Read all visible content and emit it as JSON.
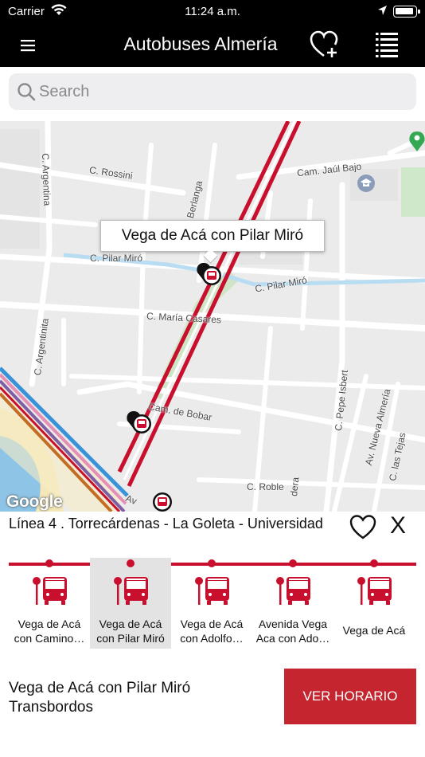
{
  "status": {
    "carrier": "Carrier",
    "time": "11:24 a.m."
  },
  "nav": {
    "title": "Autobuses Almería"
  },
  "search": {
    "placeholder": "Search",
    "value": ""
  },
  "map": {
    "callout": "Vega de Acá con Pilar Miró",
    "watermark": "Google",
    "street_labels": [
      "C. Argentina",
      "C. Rossini",
      "Cam. Jaúl Bajo",
      "C. Pilar Miró",
      "C. Pilar Miró",
      "C. María Casares",
      "C. Argentinita",
      "Cam. de Bobar",
      "C. Pepe Isbert",
      "C. Nueva Almería",
      "Av. Nueva Almería",
      "C. las Tejas",
      "C. Roble",
      "Berlanga",
      "dera",
      "Av"
    ]
  },
  "line": {
    "title": "Línea 4 . Torrecárdenas - La Goleta - Universidad",
    "close": "X"
  },
  "stops": [
    {
      "line1": "Vega de Acá",
      "line2": "con Camino…",
      "selected": false
    },
    {
      "line1": "Vega de Acá",
      "line2": "con Pilar Miró",
      "selected": true
    },
    {
      "line1": "Vega de Acá",
      "line2": "con Adolfo…",
      "selected": false
    },
    {
      "line1": "Avenida Vega",
      "line2": "Aca con Ado…",
      "selected": false
    },
    {
      "line1": "Vega de Acá",
      "line2": "",
      "selected": false
    }
  ],
  "detail": {
    "stop_name": "Vega de Acá con Pilar Miró",
    "transfers": "Transbordos",
    "schedule_button": "VER HORARIO"
  },
  "colors": {
    "brand_red": "#c8102e",
    "button_red": "#c5252f",
    "navbar": "#000000"
  },
  "icons": [
    "wifi-icon",
    "location-arrow-icon",
    "battery-icon",
    "menu-icon",
    "heart-plus-icon",
    "list-icon",
    "search-icon",
    "bus-stop-icon",
    "heart-icon",
    "close-icon"
  ]
}
